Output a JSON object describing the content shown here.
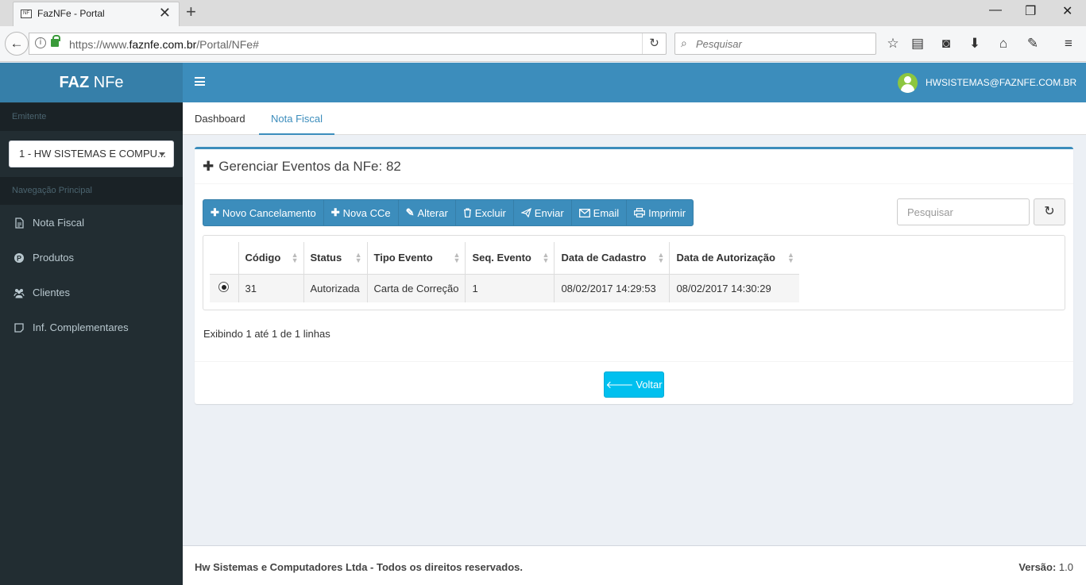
{
  "browser": {
    "tab_title": "FazNFe - Portal",
    "url_prefix": "https://www.",
    "url_domain": "faznfe.com.br",
    "url_path": "/Portal/NFe#",
    "search_placeholder": "Pesquisar",
    "favicon_text": "NF"
  },
  "brand": {
    "bold": "FAZ",
    "rest": " NFe"
  },
  "sidebar": {
    "emitente_header": "Emitente",
    "emitente_selected": "1 - HW SISTEMAS E COMPU...",
    "nav_header": "Navegação Principal",
    "items": [
      {
        "label": "Nota Fiscal",
        "icon": "file-icon"
      },
      {
        "label": "Produtos",
        "icon": "product-icon"
      },
      {
        "label": "Clientes",
        "icon": "users-icon"
      },
      {
        "label": "Inf. Complementares",
        "icon": "note-icon"
      }
    ]
  },
  "topbar": {
    "user_email": "HWSISTEMAS@FAZNFE.COM.BR"
  },
  "tabs": [
    {
      "label": "Dashboard"
    },
    {
      "label": "Nota Fiscal",
      "active": true
    }
  ],
  "box": {
    "title": "Gerenciar Eventos da NFe: 82",
    "toolbar": [
      {
        "label": "Novo Cancelamento",
        "icon": "plus-icon"
      },
      {
        "label": "Nova CCe",
        "icon": "plus-icon"
      },
      {
        "label": "Alterar",
        "icon": "pencil-icon"
      },
      {
        "label": "Excluir",
        "icon": "trash-icon"
      },
      {
        "label": "Enviar",
        "icon": "send-icon"
      },
      {
        "label": "Email",
        "icon": "envelope-icon"
      },
      {
        "label": "Imprimir",
        "icon": "print-icon"
      }
    ],
    "search_placeholder": "Pesquisar",
    "table": {
      "columns": [
        "Código",
        "Status",
        "Tipo Evento",
        "Seq. Evento",
        "Data de Cadastro",
        "Data de Autorização"
      ],
      "rows": [
        {
          "selected": true,
          "cells": [
            "31",
            "Autorizada",
            "Carta de Correção",
            "1",
            "08/02/2017 14:29:53",
            "08/02/2017 14:30:29"
          ]
        }
      ]
    },
    "pagination_info": "Exibindo 1 até 1 de 1 linhas",
    "back_label": "Voltar"
  },
  "footer": {
    "copyright": "Hw Sistemas e Computadores Ltda - Todos os direitos reservados.",
    "version_label": "Versão:",
    "version_value": " 1.0"
  },
  "colors": {
    "primary": "#3c8dbc",
    "primary_dark": "#367fa9",
    "sidebar_bg": "#222d32",
    "info": "#00c0ef",
    "avatar": "#8cc63f"
  }
}
